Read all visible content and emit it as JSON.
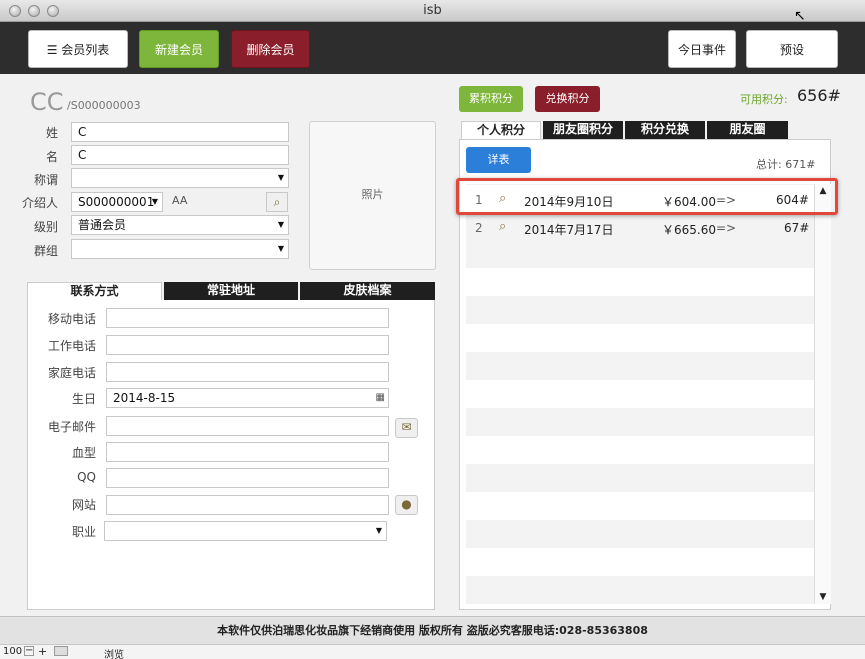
{
  "window": {
    "title": "isb"
  },
  "toolbar": {
    "member_list": "会员列表",
    "new_member": "新建会员",
    "delete_member": "删除会员",
    "today_events": "今日事件",
    "presets": "预设",
    "colors": {
      "green": "#7db63a",
      "maroon": "#8b1e2b"
    }
  },
  "member": {
    "name": "CC",
    "id": "/S000000003",
    "fields": {
      "surname_label": "姓",
      "surname": "C",
      "given_label": "名",
      "given": "C",
      "title_label": "称谓",
      "title": "",
      "referrer_label": "介绍人",
      "referrer": "S000000001",
      "referrer_name": "AA",
      "level_label": "级别",
      "level": "普通会员",
      "group_label": "群组",
      "group": ""
    },
    "photo_label": "照片"
  },
  "left_tabs": [
    "联系方式",
    "常驻地址",
    "皮肤档案"
  ],
  "contact": {
    "mobile_label": "移动电话",
    "mobile": "",
    "work_label": "工作电话",
    "work": "",
    "home_label": "家庭电话",
    "home": "",
    "birthday_label": "生日",
    "birthday": "2014-8-15",
    "email_label": "电子邮件",
    "email": "",
    "blood_label": "血型",
    "blood": "",
    "qq_label": "QQ",
    "qq": "",
    "website_label": "网站",
    "website": "",
    "job_label": "职业",
    "job": ""
  },
  "points": {
    "accumulate": "累积积分",
    "redeem": "兑换积分",
    "available_label": "可用积分:",
    "available_value": "656#",
    "tabs": [
      "个人积分",
      "朋友圈积分",
      "积分兑换",
      "朋友圈"
    ],
    "detail_button": "详表",
    "total": "总计: 671#",
    "rows": [
      {
        "n": "1",
        "date": "2014年9月10日",
        "amount": "￥604.00",
        "arrow": "=>",
        "pts": "604#"
      },
      {
        "n": "2",
        "date": "2014年7月17日",
        "amount": "￥665.60",
        "arrow": "=>",
        "pts": "67#"
      }
    ],
    "highlight_color": "#e0483a"
  },
  "footer": {
    "text": "本软件仅供泊瑞思化妆品旗下经销商使用 版权所有 盗版必究客服电话:028-85363808"
  },
  "status": {
    "zoom": "100",
    "mode": "浏览"
  }
}
